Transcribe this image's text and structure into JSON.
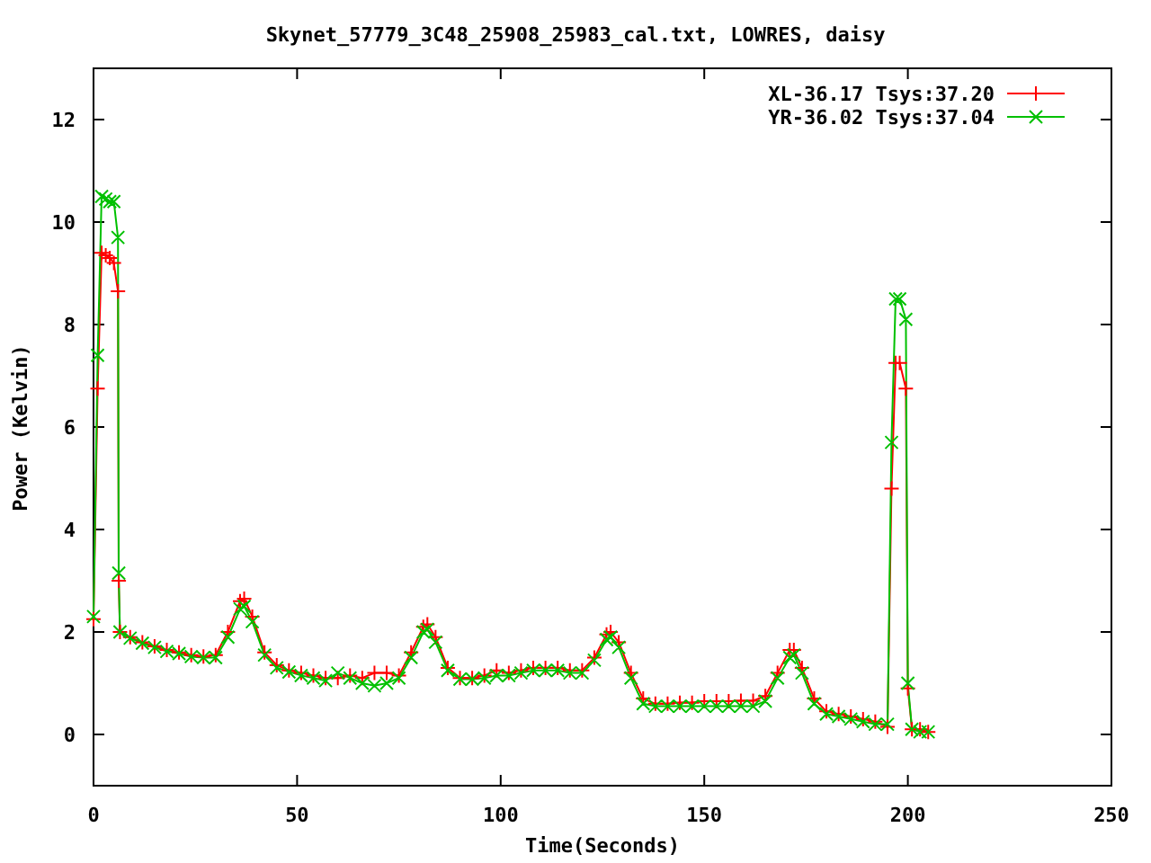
{
  "chart_data": {
    "type": "line",
    "title": "Skynet_57779_3C48_25908_25983_cal.txt, LOWRES, daisy",
    "xlabel": "Time(Seconds)",
    "ylabel": "Power (Kelvin)",
    "xlim": [
      0,
      250
    ],
    "ylim": [
      -1,
      13
    ],
    "xticks": [
      0,
      50,
      100,
      150,
      200,
      250
    ],
    "yticks": [
      0,
      2,
      4,
      6,
      8,
      10,
      12
    ],
    "legend": true,
    "x": [
      0,
      1,
      2,
      3,
      4,
      5,
      6,
      6.2,
      6.5,
      9,
      12,
      15,
      18,
      21,
      24,
      27,
      30,
      33,
      36,
      37,
      39,
      42,
      45,
      48,
      51,
      54,
      57,
      60,
      63,
      66,
      69,
      72,
      75,
      78,
      81,
      82,
      84,
      87,
      90,
      93,
      96,
      99,
      102,
      105,
      108,
      111,
      114,
      117,
      120,
      123,
      126,
      127,
      129,
      132,
      135,
      138,
      141,
      144,
      147,
      150,
      153,
      156,
      159,
      162,
      165,
      168,
      171,
      172,
      174,
      177,
      180,
      183,
      186,
      189,
      192,
      195,
      196,
      197,
      198,
      199.5,
      200,
      201,
      203,
      205
    ],
    "series": [
      {
        "name": "XL-36.17 Tsys:37.20",
        "color": "#ff0000",
        "marker": "plus",
        "values": [
          2.25,
          6.75,
          9.4,
          9.35,
          9.3,
          9.2,
          8.65,
          3.0,
          2.0,
          1.9,
          1.8,
          1.72,
          1.65,
          1.6,
          1.55,
          1.52,
          1.55,
          2.0,
          2.6,
          2.65,
          2.3,
          1.6,
          1.35,
          1.25,
          1.2,
          1.15,
          1.1,
          1.1,
          1.15,
          1.1,
          1.2,
          1.2,
          1.15,
          1.6,
          2.1,
          2.15,
          1.9,
          1.3,
          1.1,
          1.1,
          1.15,
          1.25,
          1.2,
          1.25,
          1.3,
          1.3,
          1.3,
          1.25,
          1.25,
          1.5,
          1.95,
          2.0,
          1.8,
          1.2,
          0.7,
          0.6,
          0.6,
          0.62,
          0.62,
          0.65,
          0.65,
          0.65,
          0.66,
          0.66,
          0.75,
          1.2,
          1.65,
          1.65,
          1.3,
          0.7,
          0.45,
          0.4,
          0.35,
          0.3,
          0.25,
          0.15,
          4.8,
          7.25,
          7.25,
          6.75,
          0.9,
          0.1,
          0.1,
          0.05
        ]
      },
      {
        "name": "YR-36.02 Tsys:37.04",
        "color": "#00c000",
        "marker": "cross",
        "values": [
          2.3,
          7.4,
          10.5,
          10.45,
          10.4,
          10.4,
          9.7,
          3.15,
          2.0,
          1.88,
          1.78,
          1.7,
          1.62,
          1.58,
          1.52,
          1.5,
          1.5,
          1.9,
          2.45,
          2.5,
          2.2,
          1.55,
          1.3,
          1.22,
          1.15,
          1.1,
          1.05,
          1.2,
          1.1,
          1.0,
          0.95,
          1.0,
          1.1,
          1.5,
          2.0,
          2.05,
          1.8,
          1.25,
          1.08,
          1.08,
          1.1,
          1.15,
          1.15,
          1.2,
          1.25,
          1.25,
          1.25,
          1.2,
          1.2,
          1.45,
          1.85,
          1.9,
          1.7,
          1.1,
          0.6,
          0.55,
          0.55,
          0.55,
          0.55,
          0.55,
          0.55,
          0.55,
          0.55,
          0.55,
          0.65,
          1.1,
          1.5,
          1.55,
          1.2,
          0.6,
          0.4,
          0.35,
          0.3,
          0.25,
          0.2,
          0.2,
          5.7,
          8.5,
          8.5,
          8.1,
          1.0,
          0.1,
          0.05,
          0.05
        ]
      }
    ]
  }
}
